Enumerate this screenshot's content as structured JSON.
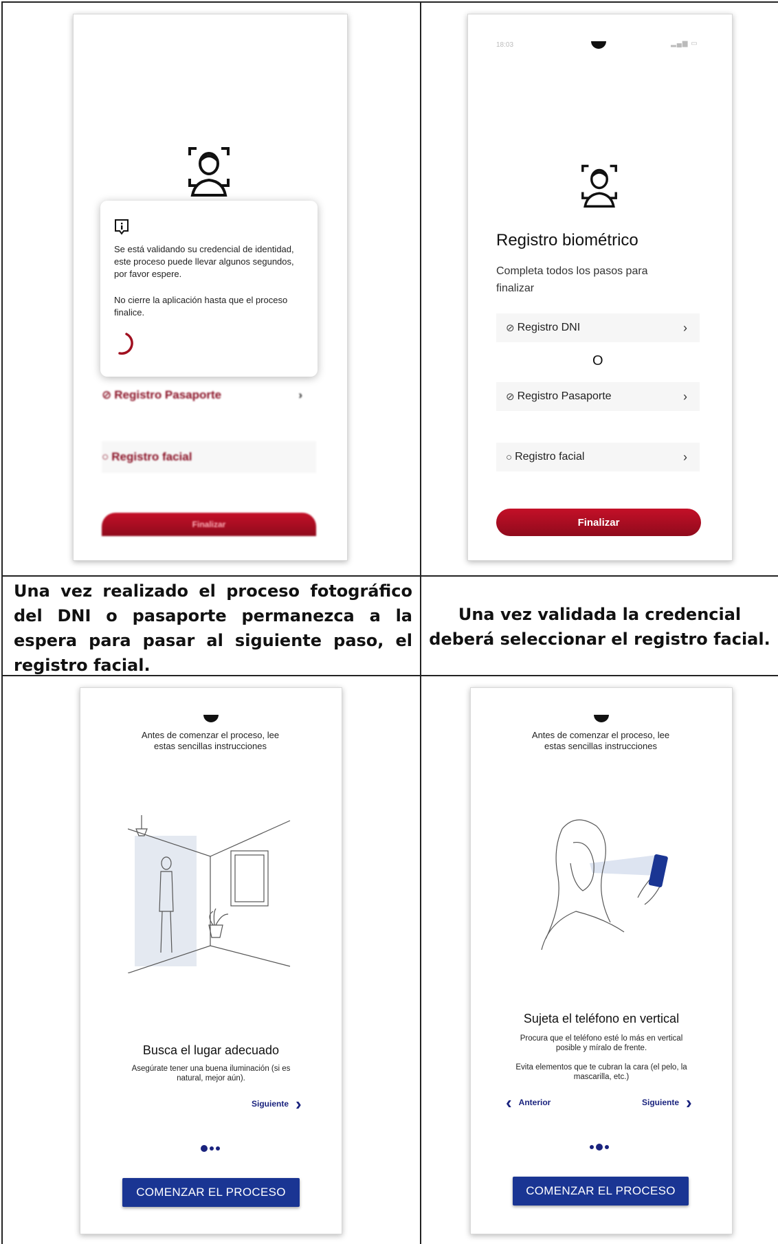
{
  "panel1": {
    "dialog_line1": "Se está validando su credencial de identidad, este proceso puede llevar algunos segundos, por favor espere.",
    "dialog_line2": "No cierre la aplicación hasta que el proceso finalice.",
    "row_passport": "Registro Pasaporte",
    "row_facial": "Registro facial",
    "finalize_button": "Finalizar"
  },
  "panel2": {
    "status_time": "18:03",
    "title": "Registro biométrico",
    "subtitle": "Completa todos los pasos para finalizar",
    "items": [
      {
        "label": "Registro DNI",
        "status": "check-circle-icon"
      },
      {
        "label": "Registro Pasaporte",
        "status": "check-circle-icon"
      },
      {
        "label": "Registro facial",
        "status": "empty-circle-icon"
      }
    ],
    "or_separator": "O",
    "finalize_button": "Finalizar"
  },
  "captions": {
    "left": "Una vez realizado el proceso fotográfico del DNI o pasaporte permanezca a la espera para pasar al siguiente paso, el registro facial.",
    "right": "Una vez validada la credencial deberá seleccionar el registro facial."
  },
  "panel3": {
    "intro": "Antes de comenzar el proceso, lee estas sencillas instrucciones",
    "heading": "Busca el lugar adecuado",
    "body": "Asegúrate tener una buena iluminación (si es natural, mejor aún).",
    "next_link": "Siguiente",
    "start_button": "COMENZAR EL PROCESO",
    "active_step": 1,
    "total_steps": 3
  },
  "panel4": {
    "intro": "Antes de comenzar el proceso, lee estas sencillas instrucciones",
    "heading": "Sujeta el teléfono en vertical",
    "body1": "Procura que el teléfono esté lo más en vertical posible y míralo de frente.",
    "body2": "Evita elementos que te cubran la cara (el pelo, la mascarilla, etc.)",
    "prev_link": "Anterior",
    "next_link": "Siguiente",
    "start_button": "COMENZAR EL PROCESO",
    "active_step": 2,
    "total_steps": 3
  },
  "colors": {
    "brand_red": "#b00e22",
    "brand_blue": "#1a3593",
    "navy_text": "#1a237e"
  }
}
